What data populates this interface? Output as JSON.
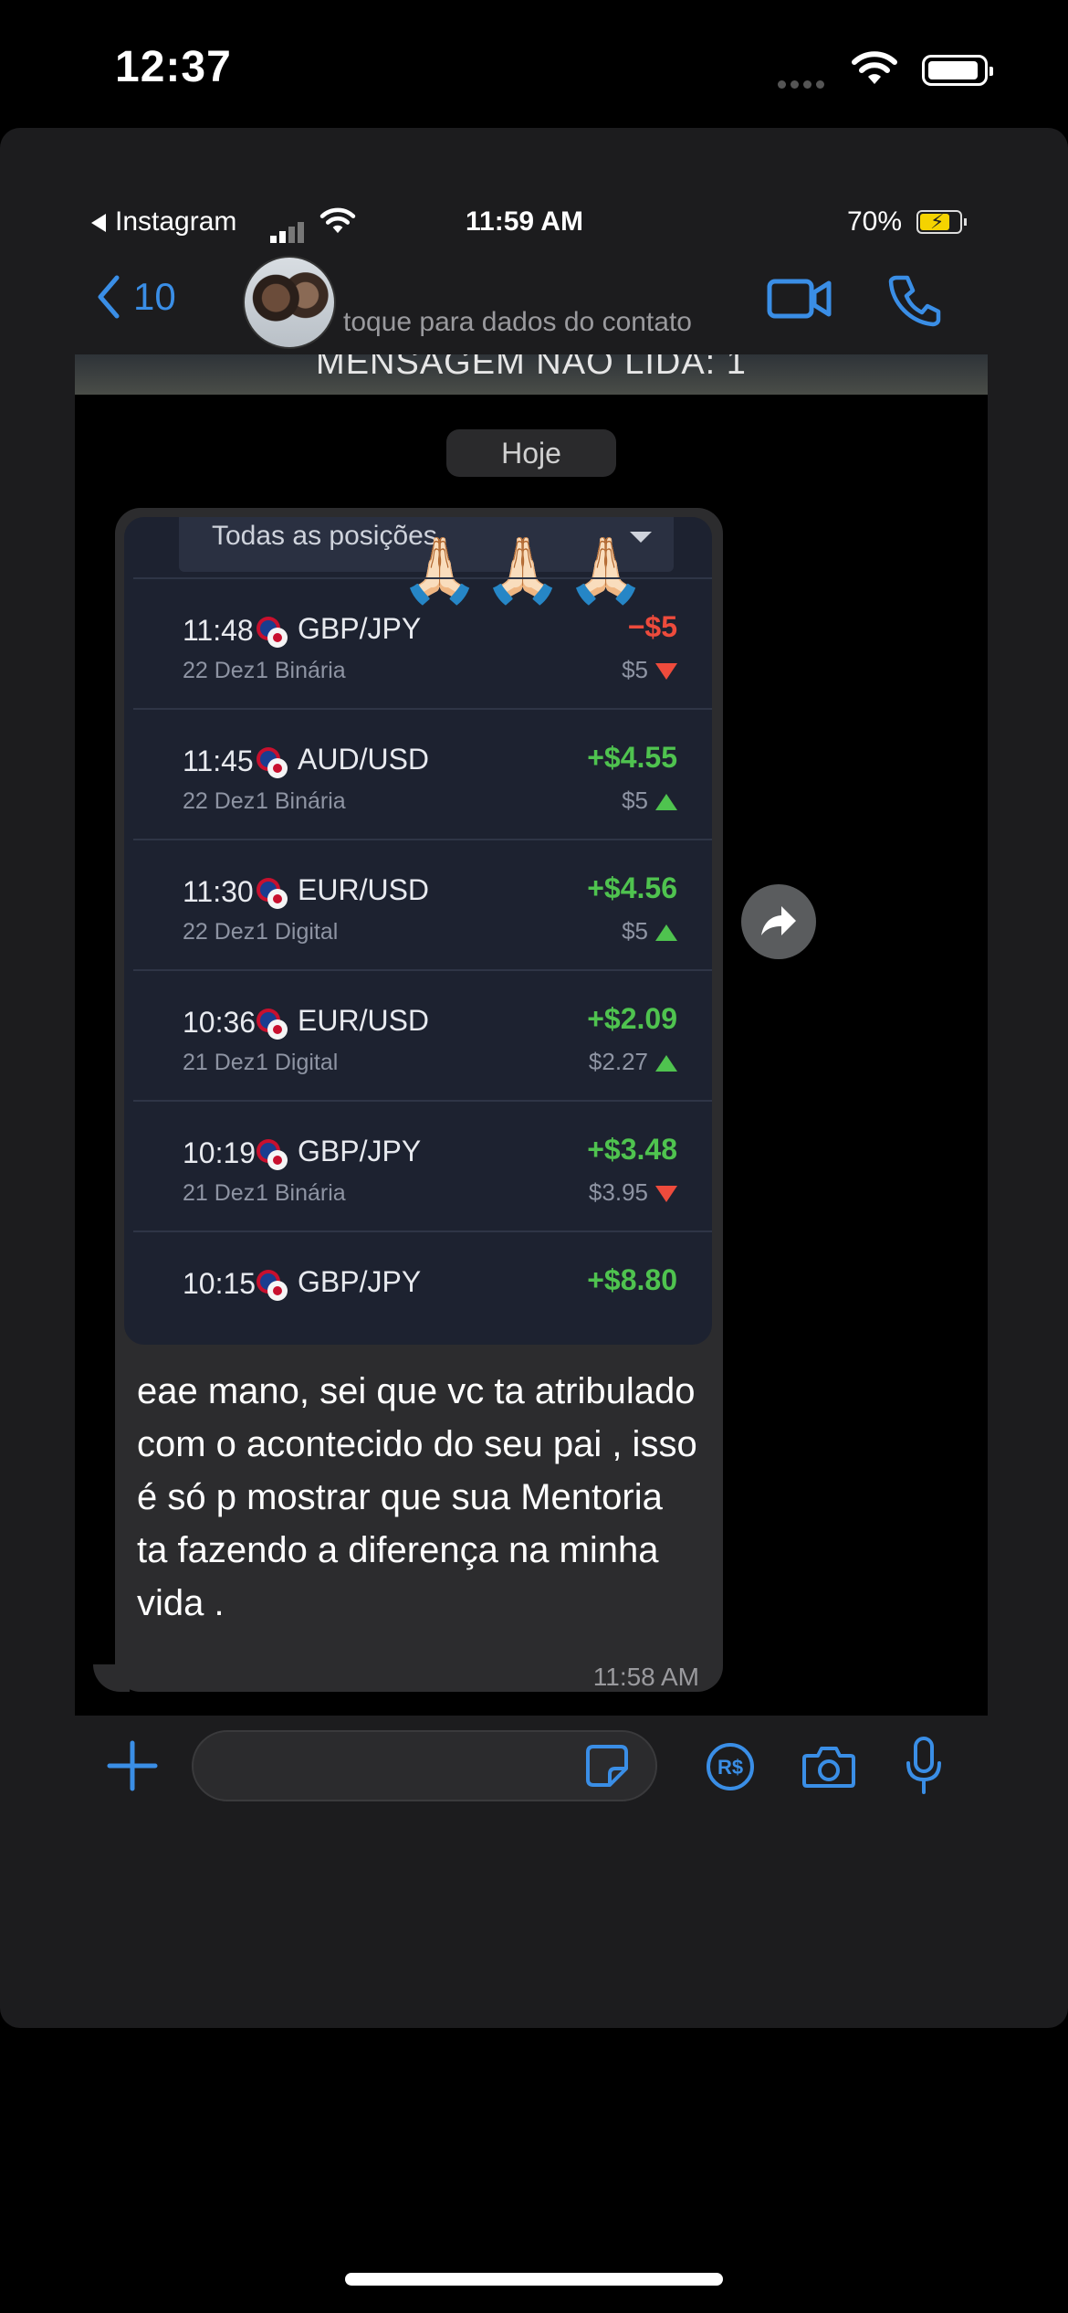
{
  "outer_status": {
    "time": "12:37"
  },
  "inner_status": {
    "back_app": "Instagram",
    "time": "11:59 AM",
    "battery": "70%"
  },
  "header": {
    "back_count": "10",
    "subtitle": "toque para dados do contato"
  },
  "chat": {
    "unread_banner": "MENSAGEM NÃO LIDA: 1",
    "date_label": "Hoje",
    "message": {
      "screenshot": {
        "filter_label": "Todas as posições",
        "emoji": "🙏🏻🙏🏻🙏🏻",
        "trades": [
          {
            "time": "11:48",
            "date": "22 Dez",
            "pair": "GBP/JPY",
            "type": "1 Binária",
            "profit": "−$5",
            "amount": "$5",
            "direction": "down",
            "profit_color": "#ee4b3c"
          },
          {
            "time": "11:45",
            "date": "22 Dez",
            "pair": "AUD/USD",
            "type": "1 Binária",
            "profit": "+$4.55",
            "amount": "$5",
            "direction": "up",
            "profit_color": "#4fc34f"
          },
          {
            "time": "11:30",
            "date": "22 Dez",
            "pair": "EUR/USD",
            "type": "1 Digital",
            "profit": "+$4.56",
            "amount": "$5",
            "direction": "up",
            "profit_color": "#4fc34f"
          },
          {
            "time": "10:36",
            "date": "21 Dez",
            "pair": "EUR/USD",
            "type": "1 Digital",
            "profit": "+$2.09",
            "amount": "$2.27",
            "direction": "up",
            "profit_color": "#4fc34f"
          },
          {
            "time": "10:19",
            "date": "21 Dez",
            "pair": "GBP/JPY",
            "type": "1 Binária",
            "profit": "+$3.48",
            "amount": "$3.95",
            "direction": "down",
            "profit_color": "#4fc34f"
          },
          {
            "time": "10:15",
            "date": "",
            "pair": "GBP/JPY",
            "type": "",
            "profit": "+$8.80",
            "amount": "",
            "direction": "",
            "profit_color": "#4fc34f"
          }
        ]
      },
      "text": "eae mano, sei que vc ta atribulado com o acontecido do seu pai , isso é só p mostrar que sua Mentoria ta fazendo a diferença na minha vida .",
      "time": "11:58 AM"
    }
  },
  "input": {
    "placeholder": "",
    "pay_label": "R$"
  },
  "colors": {
    "accent": "#3a8ee6",
    "profit_up": "#4fc34f",
    "loss": "#ee4b3c"
  },
  "icons": [
    "chevron-left-icon",
    "video-camera-icon",
    "phone-icon",
    "forward-icon",
    "plus-icon",
    "sticker-icon",
    "payment-icon",
    "camera-icon",
    "microphone-icon"
  ]
}
